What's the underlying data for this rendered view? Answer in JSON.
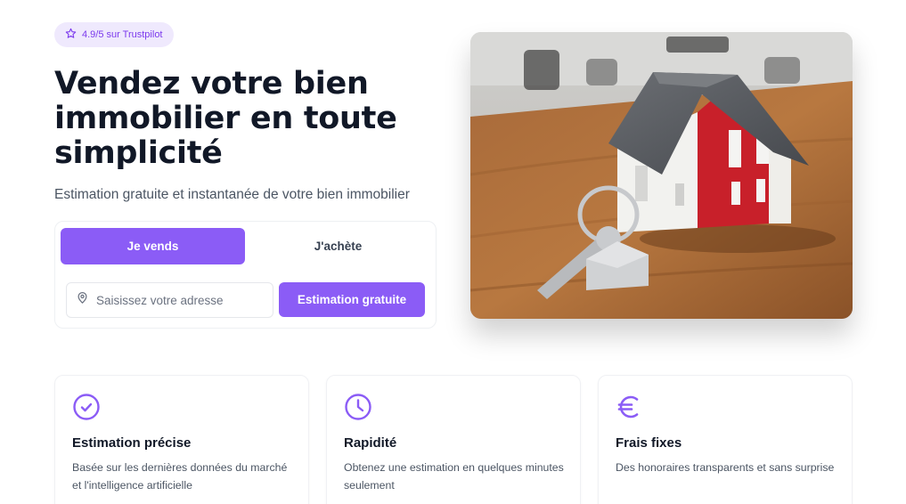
{
  "badge": {
    "text": "4.9/5 sur Trustpilot",
    "icon": "star-icon"
  },
  "hero": {
    "title": "Vendez votre bien immobilier en toute simplicité",
    "subtitle": "Estimation gratuite et instantanée de votre bien immobilier"
  },
  "form": {
    "tabs": [
      {
        "label": "Je vends",
        "active": true
      },
      {
        "label": "J'achète",
        "active": false
      }
    ],
    "address_placeholder": "Saisissez votre adresse",
    "address_value": "",
    "cta_label": "Estimation gratuite",
    "input_icon": "map-pin-icon"
  },
  "features": [
    {
      "icon": "check-circle-icon",
      "title": "Estimation précise",
      "description": "Basée sur les dernières données du marché et l'intelligence artificielle"
    },
    {
      "icon": "clock-icon",
      "title": "Rapidité",
      "description": "Obtenez une estimation en quelques minutes seulement"
    },
    {
      "icon": "euro-icon",
      "title": "Frais fixes",
      "description": "Des honoraires transparents et sans surprise"
    }
  ],
  "colors": {
    "accent": "#8b5cf6",
    "badge_bg": "#efe9fd",
    "heading": "#111827",
    "muted": "#4b5563"
  }
}
